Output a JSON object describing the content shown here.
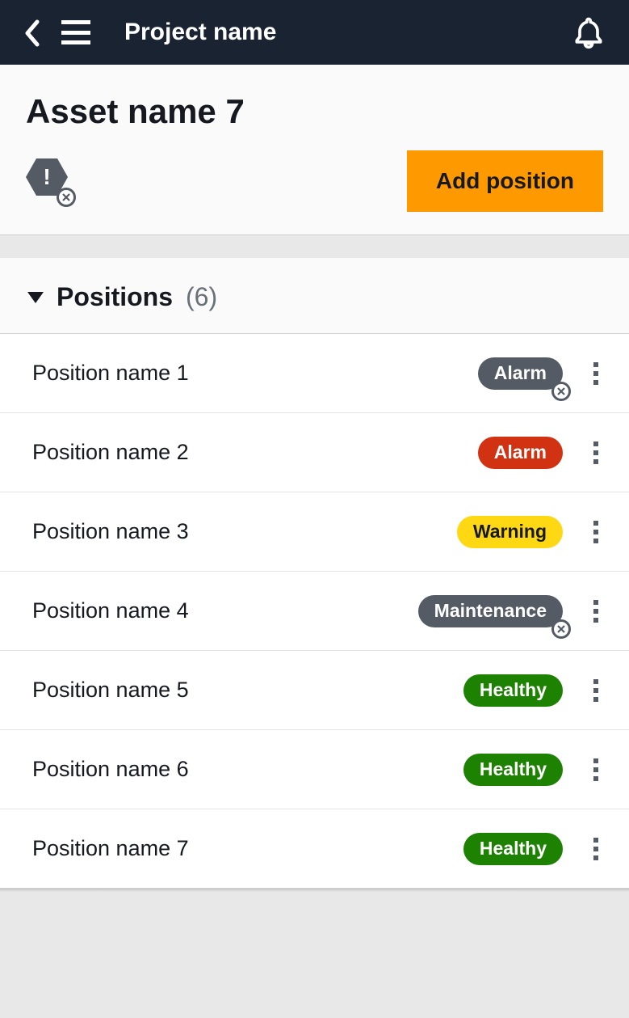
{
  "navbar": {
    "project_title": "Project name"
  },
  "asset": {
    "title": "Asset name 7",
    "add_button_label": "Add position"
  },
  "positions": {
    "label": "Positions",
    "count_display": "(6)",
    "items": [
      {
        "name": "Position name 1",
        "status_label": "Alarm",
        "status_kind": "gray",
        "cancel_overlay": true
      },
      {
        "name": "Position name 2",
        "status_label": "Alarm",
        "status_kind": "red",
        "cancel_overlay": false
      },
      {
        "name": "Position name 3",
        "status_label": "Warning",
        "status_kind": "yellow",
        "cancel_overlay": false
      },
      {
        "name": "Position name 4",
        "status_label": "Maintenance",
        "status_kind": "gray",
        "cancel_overlay": true
      },
      {
        "name": "Position name 5",
        "status_label": "Healthy",
        "status_kind": "green",
        "cancel_overlay": false
      },
      {
        "name": "Position name 6",
        "status_label": "Healthy",
        "status_kind": "green",
        "cancel_overlay": false
      },
      {
        "name": "Position name 7",
        "status_label": "Healthy",
        "status_kind": "green",
        "cancel_overlay": false
      }
    ]
  }
}
